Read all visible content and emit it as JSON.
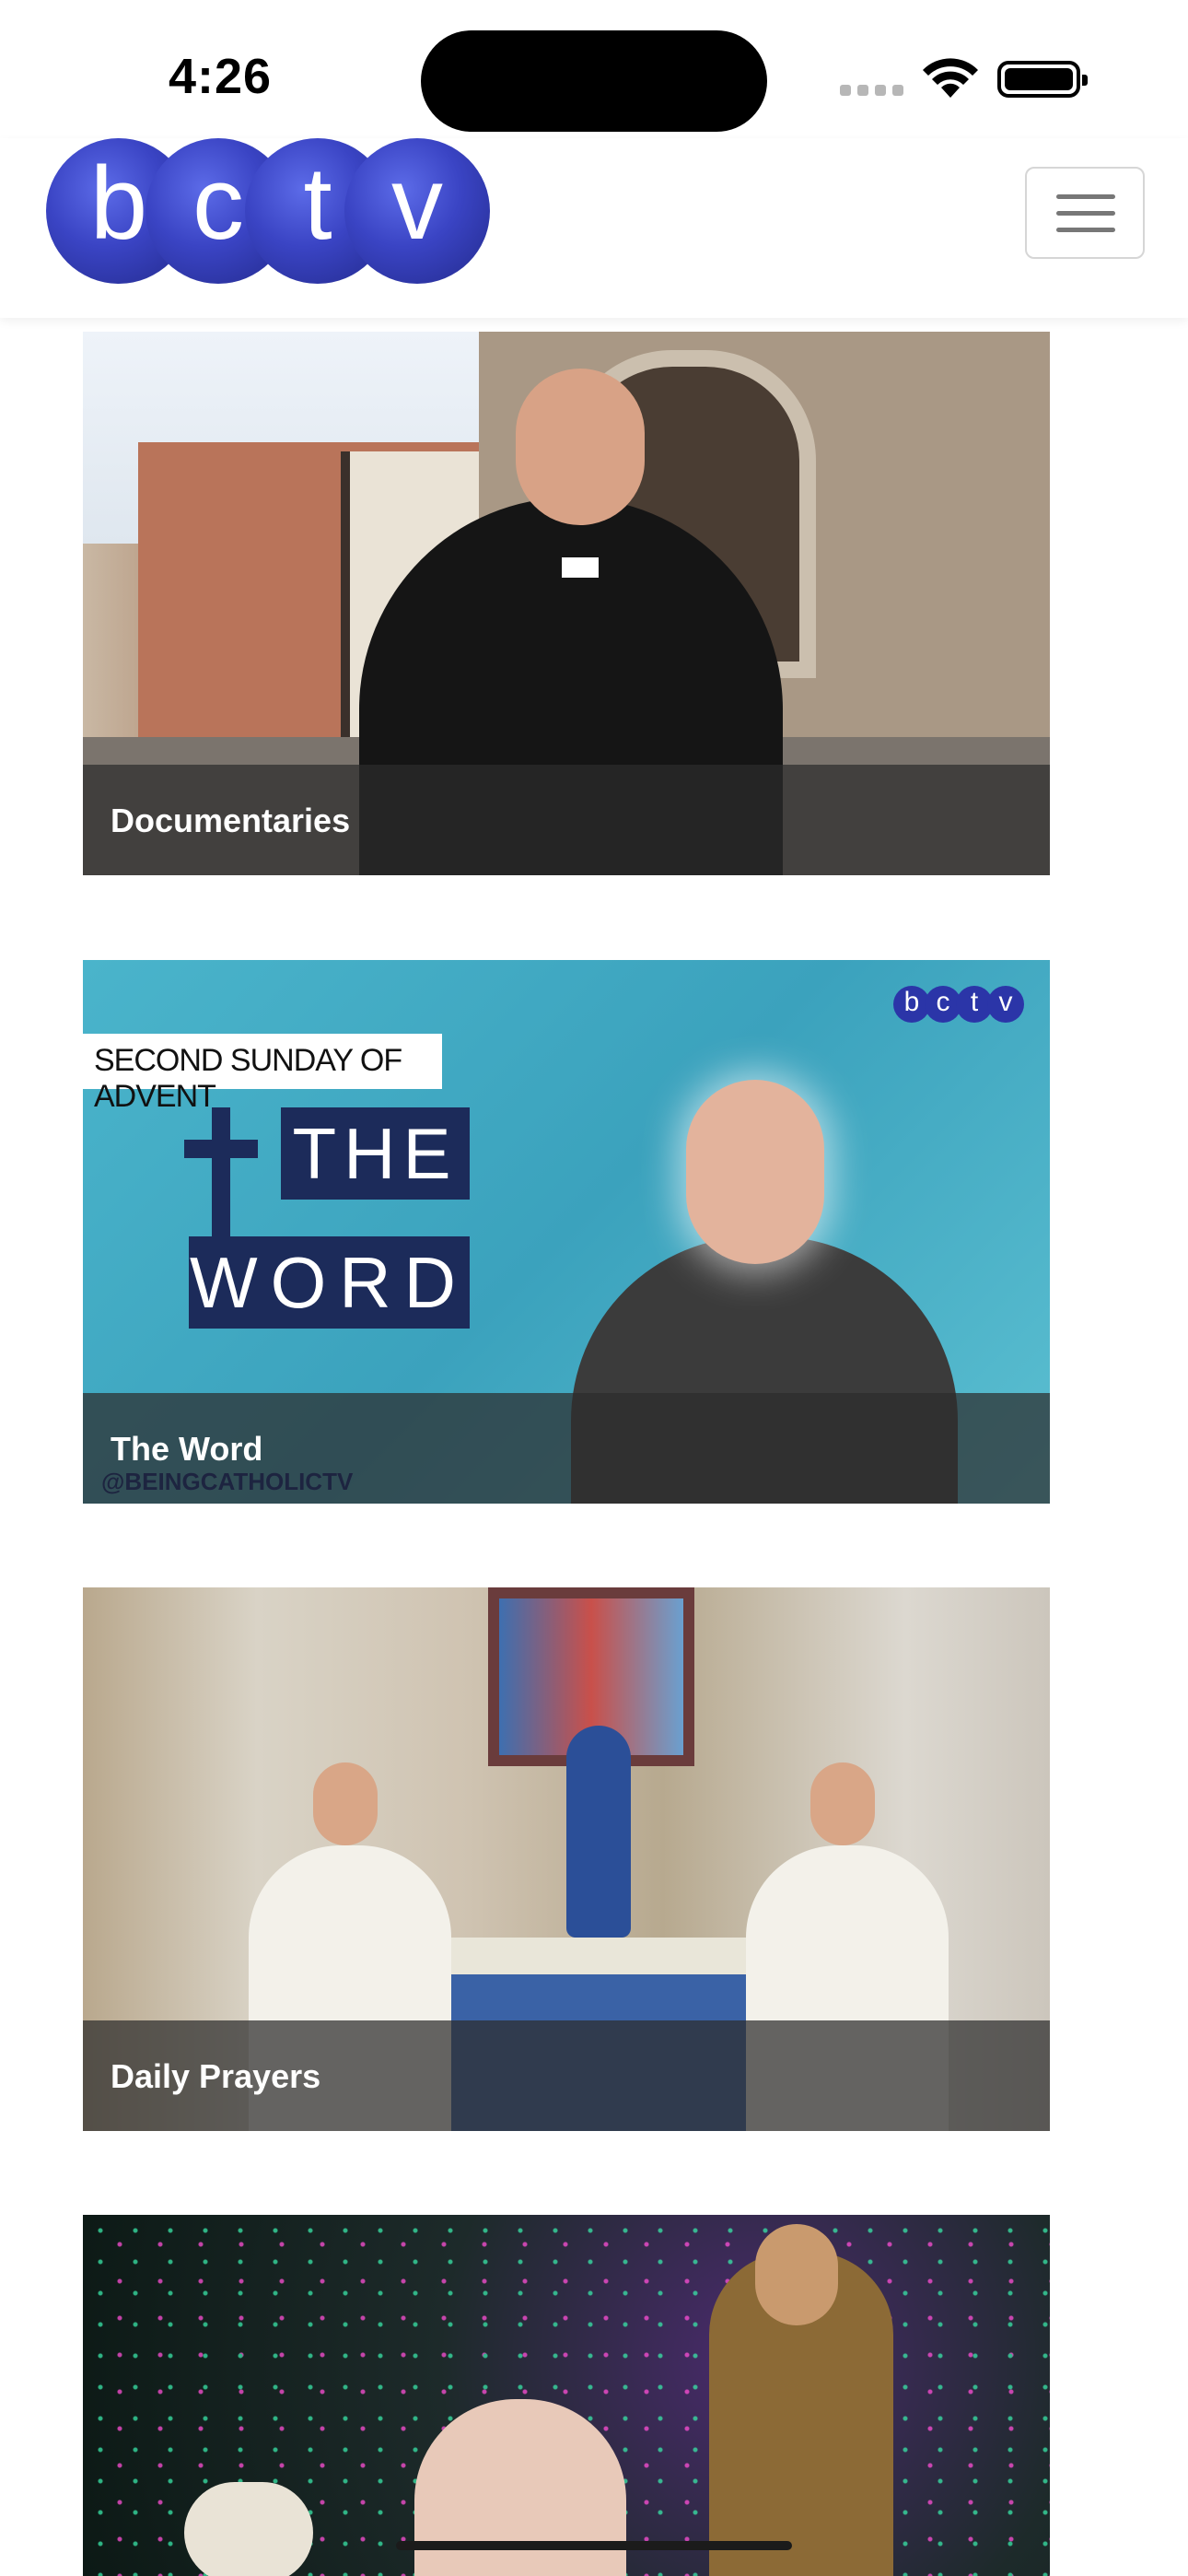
{
  "status_bar": {
    "time": "4:26"
  },
  "header": {
    "logo_letters": [
      "b",
      "c",
      "t",
      "v"
    ],
    "menu_icon": "hamburger-icon"
  },
  "categories": [
    {
      "label": "Documentaries"
    },
    {
      "label": "The Word",
      "art_tag": "SECOND SUNDAY OF ADVENT",
      "art_title_1": "THE",
      "art_title_2": "WORD",
      "art_handle": "@BEINGCATHOLICTV"
    },
    {
      "label": "Daily Prayers"
    },
    {
      "label": ""
    }
  ],
  "colors": {
    "brand_blue": "#3a44c4",
    "caption_overlay": "#2d2d2d"
  }
}
